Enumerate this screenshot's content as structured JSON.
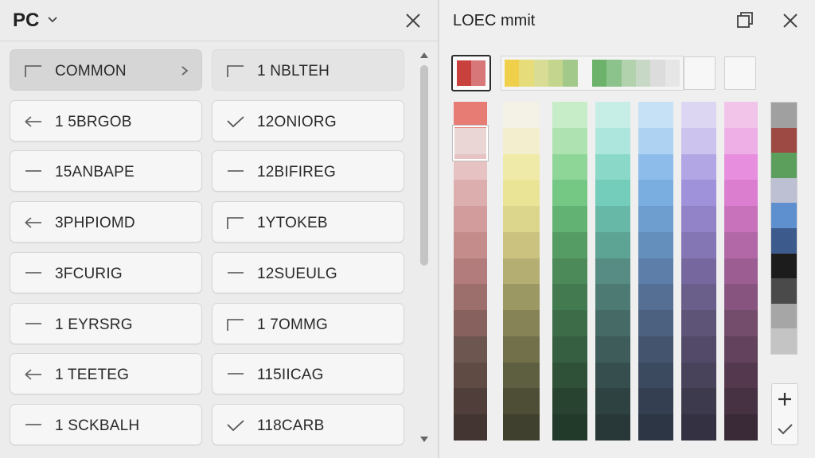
{
  "left_panel": {
    "title": "PC",
    "items": [
      {
        "label": "COMMON",
        "icon": "corner-bracket-icon",
        "selected": true,
        "has_chevron": true
      },
      {
        "label": "1 NBLTEH",
        "icon": "corner-bracket-icon",
        "dim": true
      },
      {
        "label": "1 5BRGOB",
        "icon": "arrow-left-icon"
      },
      {
        "label": "12ONIORG",
        "icon": "checkmark-icon"
      },
      {
        "label": "15ANBAPE",
        "icon": "dash-icon"
      },
      {
        "label": "12BIFIREG",
        "icon": "dash-icon"
      },
      {
        "label": "3PHPIOMD",
        "icon": "arrow-left-icon"
      },
      {
        "label": "1YTOKEB",
        "icon": "corner-bracket-icon"
      },
      {
        "label": "3FCURIG",
        "icon": "dash-icon"
      },
      {
        "label": "12SUEULG",
        "icon": "dash-icon"
      },
      {
        "label": "1 EYRSRG",
        "icon": "dash-icon"
      },
      {
        "label": "1 7OMMG",
        "icon": "corner-bracket-icon"
      },
      {
        "label": "1 TEETEG",
        "icon": "arrow-left-icon"
      },
      {
        "label": "115IICAG",
        "icon": "dash-icon"
      },
      {
        "label": "1 SCKBALH",
        "icon": "dash-icon"
      },
      {
        "label": "118CARB",
        "icon": "checkmark-icon"
      }
    ]
  },
  "right_panel": {
    "title": "LOEC  mmit",
    "current_swatch": [
      "#c8413d",
      "#d8777a"
    ],
    "recent_colors": [
      "#f0d04a",
      "#e6dc7a",
      "#d8dc94",
      "#c4d68e",
      "#a2c98a",
      "#f4f4f4",
      "#6cb26a",
      "#8cc28c",
      "#b2d2ae",
      "#c8d8c6",
      "#dcdcdc",
      "#e6e6e6"
    ],
    "palette_columns": [
      [
        "#e77c74",
        "#ebd6d6",
        "#e6c2c2",
        "#ddaeae",
        "#d29c9c",
        "#c58c8c",
        "#b27c7c",
        "#9c6e6c",
        "#87615d",
        "#6e5650",
        "#5f4a44",
        "#4f3e3a",
        "#433532"
      ],
      [
        "#f4f2e6",
        "#f3efce",
        "#f0eaa8",
        "#eae496",
        "#dcd68c",
        "#cac27e",
        "#b4ae72",
        "#9c9864",
        "#868456",
        "#72704a",
        "#5e5e40",
        "#4e4e36",
        "#40402e"
      ],
      [
        "#c6ecc8",
        "#aee2b0",
        "#8ed698",
        "#74c884",
        "#62b274",
        "#559c64",
        "#4c8a5a",
        "#437a50",
        "#3c6c48",
        "#365e40",
        "#2f5138",
        "#284430",
        "#223a2a"
      ],
      [
        "#c6eee6",
        "#ace6dc",
        "#8ad8c8",
        "#74ccba",
        "#68b8a8",
        "#5ea494",
        "#568c84",
        "#4e7a74",
        "#466a66",
        "#3e5c5a",
        "#364e4e",
        "#2e4242",
        "#283838"
      ],
      [
        "#c6e0f6",
        "#aed2f2",
        "#8ebcea",
        "#7aaee0",
        "#6e9ed0",
        "#648ebc",
        "#5c7ea8",
        "#546e94",
        "#4c6080",
        "#44546e",
        "#3c4a60",
        "#344052",
        "#2c3644"
      ],
      [
        "#dcd6f2",
        "#ccc4ee",
        "#b2a6e4",
        "#a092da",
        "#9282c8",
        "#8476b4",
        "#76689e",
        "#6a5e8a",
        "#5e5478",
        "#524a68",
        "#48425a",
        "#3e3a4e",
        "#343242"
      ],
      [
        "#f2c4ea",
        "#eeaee6",
        "#e88ede",
        "#dc7ed0",
        "#c872bc",
        "#b268a6",
        "#9c5e92",
        "#86547e",
        "#744c6c",
        "#62425c",
        "#54394e",
        "#463242",
        "#3a2a38"
      ]
    ],
    "side_colors": [
      "#a0a0a0",
      "#9e4a44",
      "#5c9e5c",
      "#bcc0d2",
      "#5e90d0",
      "#3c5a8c",
      "#1c1c1c",
      "#4a4a4a",
      "#a6a6a6",
      "#c4c4c4"
    ]
  }
}
